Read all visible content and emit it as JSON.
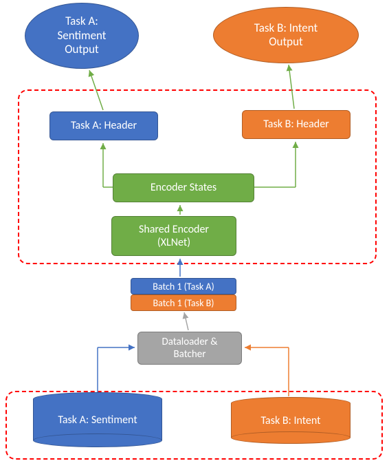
{
  "diagram": {
    "task_a_output": "Task A:\nSentiment\nOutput",
    "task_b_output": "Task B: Intent\nOutput",
    "task_a_header": "Task A: Header",
    "task_b_header": "Task B: Header",
    "encoder_states": "Encoder States",
    "shared_encoder": "Shared Encoder\n(XLNet)",
    "batch_a": "Batch 1 (Task A)",
    "batch_b": "Batch 1 (Task B)",
    "dataloader": "Dataloader &\nBatcher",
    "task_a_data": "Task A: Sentiment",
    "task_b_data": "Task B: Intent"
  },
  "colors": {
    "blue": "#4472c4",
    "orange": "#ed7d31",
    "green": "#70ad47",
    "gray": "#a5a5a5"
  }
}
